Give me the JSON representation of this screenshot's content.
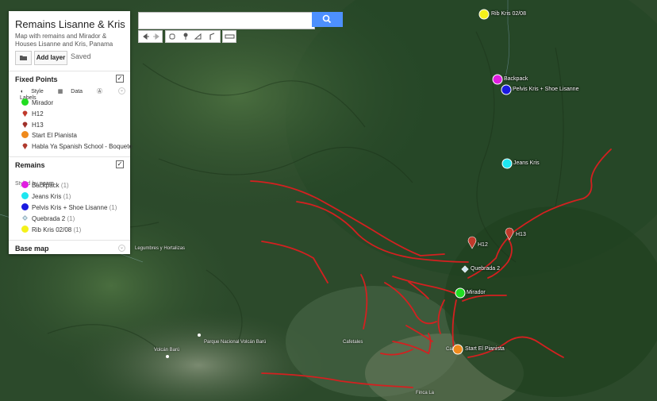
{
  "panel": {
    "title": "Remains Lisanne & Kris",
    "description": "Map with remains and Mirador & Houses Lisanne and Kris, Panama",
    "add_layer": "Add layer",
    "saved": "Saved",
    "fixed_points": {
      "heading": "Fixed Points",
      "tools": [
        "Style",
        "Data",
        "Labels"
      ],
      "items": [
        {
          "label": "Mirador",
          "icon": "green-dot-icon",
          "color": "#22dd22"
        },
        {
          "label": "H12",
          "icon": "red-pin-icon",
          "color": "#c0392b"
        },
        {
          "label": "H13",
          "icon": "red-pin-icon",
          "color": "#a0302a"
        },
        {
          "label": "Start El Pianista",
          "icon": "orange-dot-icon",
          "color": "#ef8a1d"
        },
        {
          "label": "Habla Ya Spanish School - Boquete",
          "icon": "red-pin-icon",
          "color": "#b03a2e"
        }
      ]
    },
    "remains": {
      "heading": "Remains",
      "styled_by_prefix": "Styled by",
      "styled_by_value": "naam",
      "items": [
        {
          "label": "Backpack",
          "count": "(1)",
          "icon": "magenta-dot-icon",
          "color": "#e01ee0"
        },
        {
          "label": "Jeans Kris",
          "count": "(1)",
          "icon": "cyan-dot-icon",
          "color": "#1ee6f0"
        },
        {
          "label": "Pelvis Kris + Shoe Lisanne",
          "count": "(1)",
          "icon": "blue-dot-icon",
          "color": "#1a1ae0"
        },
        {
          "label": "Quebrada 2",
          "count": "(1)",
          "icon": "diamond-icon",
          "color": "#cfe6f0"
        },
        {
          "label": "Rib Kris 02/08",
          "count": "(1)",
          "icon": "yellow-dot-icon",
          "color": "#f4f11a"
        }
      ]
    },
    "base_map": "Base map"
  },
  "search": {
    "placeholder": ""
  },
  "map": {
    "markers": [
      {
        "label": "Rib Kris 02/08",
        "color": "#f4f11a"
      },
      {
        "label": "Backpack",
        "color": "#e01ee0"
      },
      {
        "label": "Pelvis Kris + Shoe Lisanne",
        "color": "#1a1ae0"
      },
      {
        "label": "Jeans Kris",
        "color": "#1ee6f0"
      },
      {
        "label": "H13",
        "color": "#c0392b"
      },
      {
        "label": "H12",
        "color": "#c0392b"
      },
      {
        "label": "Quebrada 2",
        "color": "#cfe6f0"
      },
      {
        "label": "Mirador",
        "color": "#22dd22"
      },
      {
        "label": "Start El Pianista",
        "color": "#ef8a1d"
      }
    ],
    "places": [
      "Legumbres y Hortalizas",
      "Parque Nacional Volcán Barú",
      "Volcán Barú",
      "Cafetales",
      "Finca La",
      "Calde"
    ],
    "accent_color": "#4d90fe",
    "trail_color": "#d42020"
  }
}
